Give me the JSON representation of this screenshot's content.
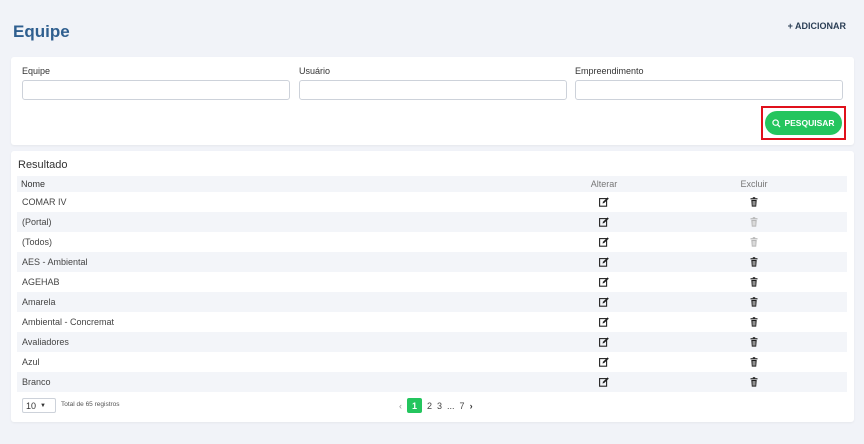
{
  "page": {
    "title": "Equipe",
    "add_label": "+ ADICIONAR"
  },
  "filters": {
    "equipe_label": "Equipe",
    "usuario_label": "Usuário",
    "empreendimento_label": "Empreendimento",
    "search_label": "PESQUISAR"
  },
  "results": {
    "title": "Resultado",
    "columns": [
      "Nome",
      "Alterar",
      "Excluir"
    ],
    "rows": [
      {
        "nome": " COMAR IV",
        "delete_enabled": true
      },
      {
        "nome": "(Portal)",
        "delete_enabled": false
      },
      {
        "nome": "(Todos)",
        "delete_enabled": false
      },
      {
        "nome": "AES - Ambiental",
        "delete_enabled": true
      },
      {
        "nome": "AGEHAB",
        "delete_enabled": true
      },
      {
        "nome": "Amarela",
        "delete_enabled": true
      },
      {
        "nome": "Ambiental - Concremat",
        "delete_enabled": true
      },
      {
        "nome": "Avaliadores",
        "delete_enabled": true
      },
      {
        "nome": "Azul",
        "delete_enabled": true
      },
      {
        "nome": "Branco",
        "delete_enabled": true
      }
    ]
  },
  "footer": {
    "page_size": "10",
    "total_text": "Total de 65 registros",
    "pages": [
      "1",
      "2",
      "3",
      "...",
      "7"
    ],
    "current_page": "1"
  },
  "icons": {
    "edit": "edit-icon",
    "delete": "trash-icon",
    "search": "search-icon"
  },
  "colors": {
    "accent_green": "#24c55e",
    "title_blue": "#2f5f8f",
    "highlight_red": "#e0101b"
  }
}
